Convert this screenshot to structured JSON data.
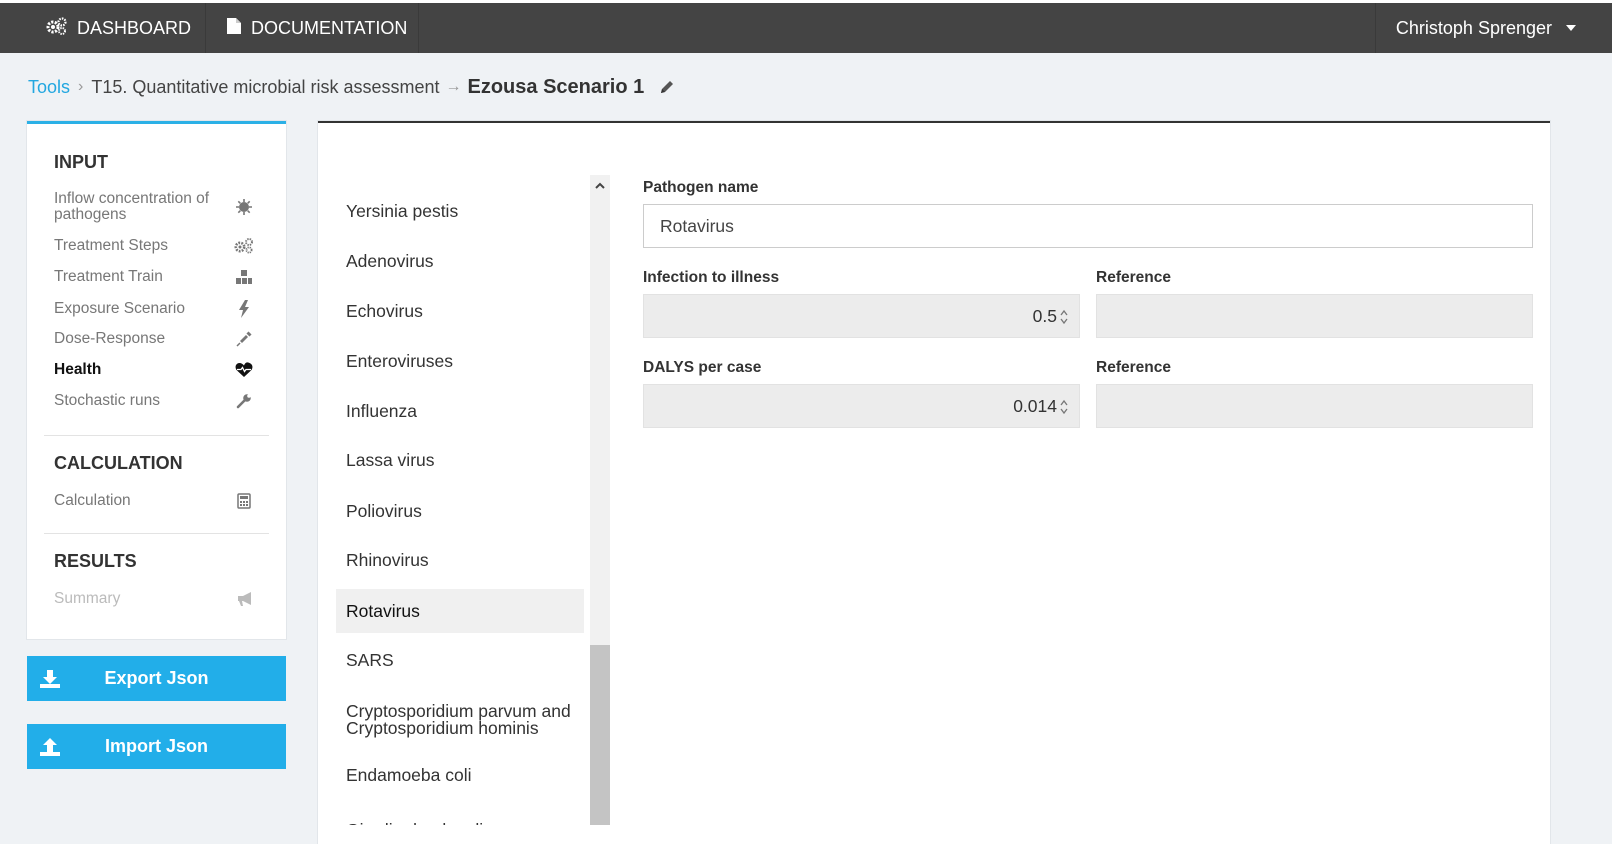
{
  "topbar": {
    "dashboard_label": "DASHBOARD",
    "documentation_label": "DOCUMENTATION",
    "user_name": "Christoph Sprenger"
  },
  "breadcrumb": {
    "tools": "Tools",
    "tool_name": "T15. Quantitative microbial risk assessment",
    "scenario": "Ezousa Scenario 1"
  },
  "sidebar": {
    "input_title": "INPUT",
    "input_items": [
      {
        "label": "Inflow concentration of pathogens",
        "icon": "virus-icon"
      },
      {
        "label": "Treatment Steps",
        "icon": "cogs-icon"
      },
      {
        "label": "Treatment Train",
        "icon": "cubes-icon"
      },
      {
        "label": "Exposure Scenario",
        "icon": "bolt-icon"
      },
      {
        "label": "Dose-Response",
        "icon": "syringe-icon"
      },
      {
        "label": "Health",
        "icon": "heartbeat-icon"
      },
      {
        "label": "Stochastic runs",
        "icon": "wrench-icon"
      }
    ],
    "calculation_title": "CALCULATION",
    "calculation_item": "Calculation",
    "results_title": "RESULTS",
    "results_item": "Summary",
    "export_label": "Export Json",
    "import_label": "Import Json"
  },
  "pathogens": [
    "Yersinia pestis",
    "Adenovirus",
    "Echovirus",
    "Enteroviruses",
    "Influenza",
    "Lassa virus",
    "Poliovirus",
    "Rhinovirus",
    "Rotavirus",
    "SARS",
    "Cryptosporidium parvum and Cryptosporidium hominis",
    "Endamoeba coli",
    "Giardia duodenalis"
  ],
  "selected_pathogen": "Rotavirus",
  "form": {
    "pathogen_name_label": "Pathogen name",
    "pathogen_name_value": "Rotavirus",
    "infection_label": "Infection to illness",
    "infection_value": "0.5",
    "reference_label_1": "Reference",
    "dalys_label": "DALYS per case",
    "dalys_value": "0.014",
    "reference_label_2": "Reference"
  },
  "colors": {
    "accent": "#22aee9",
    "topbar": "#444444",
    "link": "#22a7e0"
  }
}
